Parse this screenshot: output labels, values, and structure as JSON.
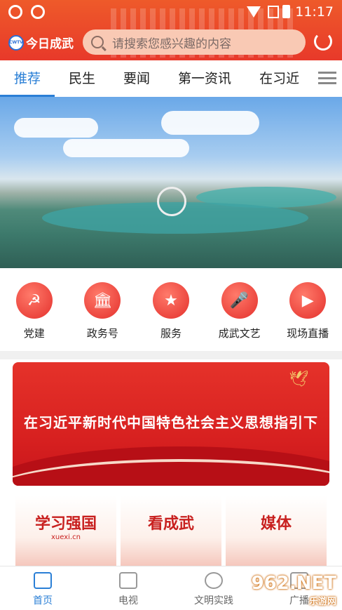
{
  "status": {
    "time": "11:17"
  },
  "header": {
    "logo_text": "今日成武",
    "logo_mark": "CWTV",
    "search_placeholder": "请搜索您感兴趣的内容"
  },
  "tabs": [
    {
      "label": "推荐",
      "active": true
    },
    {
      "label": "民生"
    },
    {
      "label": "要闻"
    },
    {
      "label": "第一资讯"
    },
    {
      "label": "在习近"
    }
  ],
  "quick_links": [
    {
      "label": "党建",
      "icon": "party-emblem-icon",
      "glyph": "☭"
    },
    {
      "label": "政务号",
      "icon": "government-building-icon",
      "glyph": "🏛"
    },
    {
      "label": "服务",
      "icon": "bookmark-star-icon",
      "glyph": "★"
    },
    {
      "label": "成武文艺",
      "icon": "microphone-icon",
      "glyph": "🎤"
    },
    {
      "label": "现场直播",
      "icon": "video-camera-icon",
      "glyph": "▶"
    }
  ],
  "promo": {
    "text": "在习近平新时代中国特色社会主义思想指引下"
  },
  "cards": [
    {
      "title": "学习强国",
      "sub": "xuexi.cn"
    },
    {
      "title": "看成武",
      "sub": ""
    },
    {
      "title": "媒体",
      "sub": ""
    }
  ],
  "bottom_nav": [
    {
      "label": "首页",
      "active": true,
      "icon": "home-icon"
    },
    {
      "label": "电视",
      "icon": "tv-icon"
    },
    {
      "label": "文明实践",
      "icon": "civilization-icon"
    },
    {
      "label": "广播",
      "icon": "radio-icon"
    }
  ],
  "watermark": {
    "main": "962.NET",
    "sub": "乐游网"
  },
  "colors": {
    "brand_red": "#e8392a",
    "accent_blue": "#2a7fd6"
  }
}
